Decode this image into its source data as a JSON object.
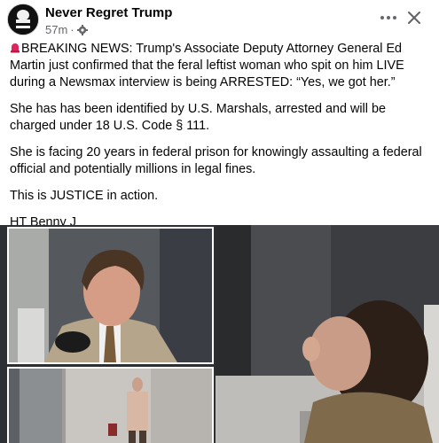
{
  "post": {
    "author": "Never Regret Trump",
    "timestamp": "57m",
    "separator": "·",
    "audience_icon": "gear-icon",
    "paragraphs": [
      "BREAKING NEWS: Trump's Associate Deputy Attorney General Ed Martin just confirmed that the feral leftist woman who spit on him LIVE during a Newsmax interview is being ARRESTED: “Yes, we got her.”",
      "She has has been identified by U.S. Marshals, arrested and will be charged under 18 U.S. Code § 111.",
      "She is facing 20 years in federal prison for knowingly assaulting a federal official and potentially millions in legal fines.",
      "This is JUSTICE in action.",
      "HT Benny J"
    ],
    "lead_emoji": "siren-icon"
  },
  "header_actions": {
    "more_icon": "more-options-icon",
    "close_icon": "close-icon"
  },
  "media": {
    "images": [
      "man-interview-photo",
      "woman-street-photo",
      "woman-closeup-photo"
    ]
  },
  "colors": {
    "text": "#050505",
    "secondary_text": "#65676b",
    "background": "#ffffff",
    "siren_red": "#e0245e"
  }
}
